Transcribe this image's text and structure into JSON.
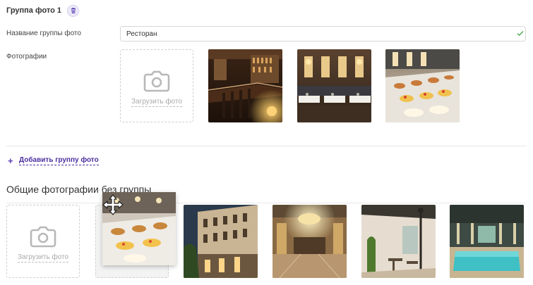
{
  "group": {
    "title": "Группа фото 1",
    "trash_icon": "trash-icon",
    "name_label": "Название группы фото",
    "name_value": "Ресторан",
    "photos_label": "Фотографии",
    "upload_label": "Загрузить фото",
    "photos": [
      {
        "subject": "restaurant-bar-photo"
      },
      {
        "subject": "restaurant-hall-photo"
      },
      {
        "subject": "buffet-desserts-photo"
      }
    ]
  },
  "add_group_label": "Добавить группу фото",
  "common": {
    "title": "Общие фотографии без группы",
    "upload_label": "Загрузить фото",
    "dragged_photo": "buffet-photo",
    "photos": [
      {
        "subject": "hotel-facade-photo"
      },
      {
        "subject": "hotel-lobby-photo"
      },
      {
        "subject": "terrace-photo"
      },
      {
        "subject": "indoor-pool-photo"
      }
    ]
  },
  "colors": {
    "accent": "#5b3fb5",
    "valid": "#4caf50"
  }
}
